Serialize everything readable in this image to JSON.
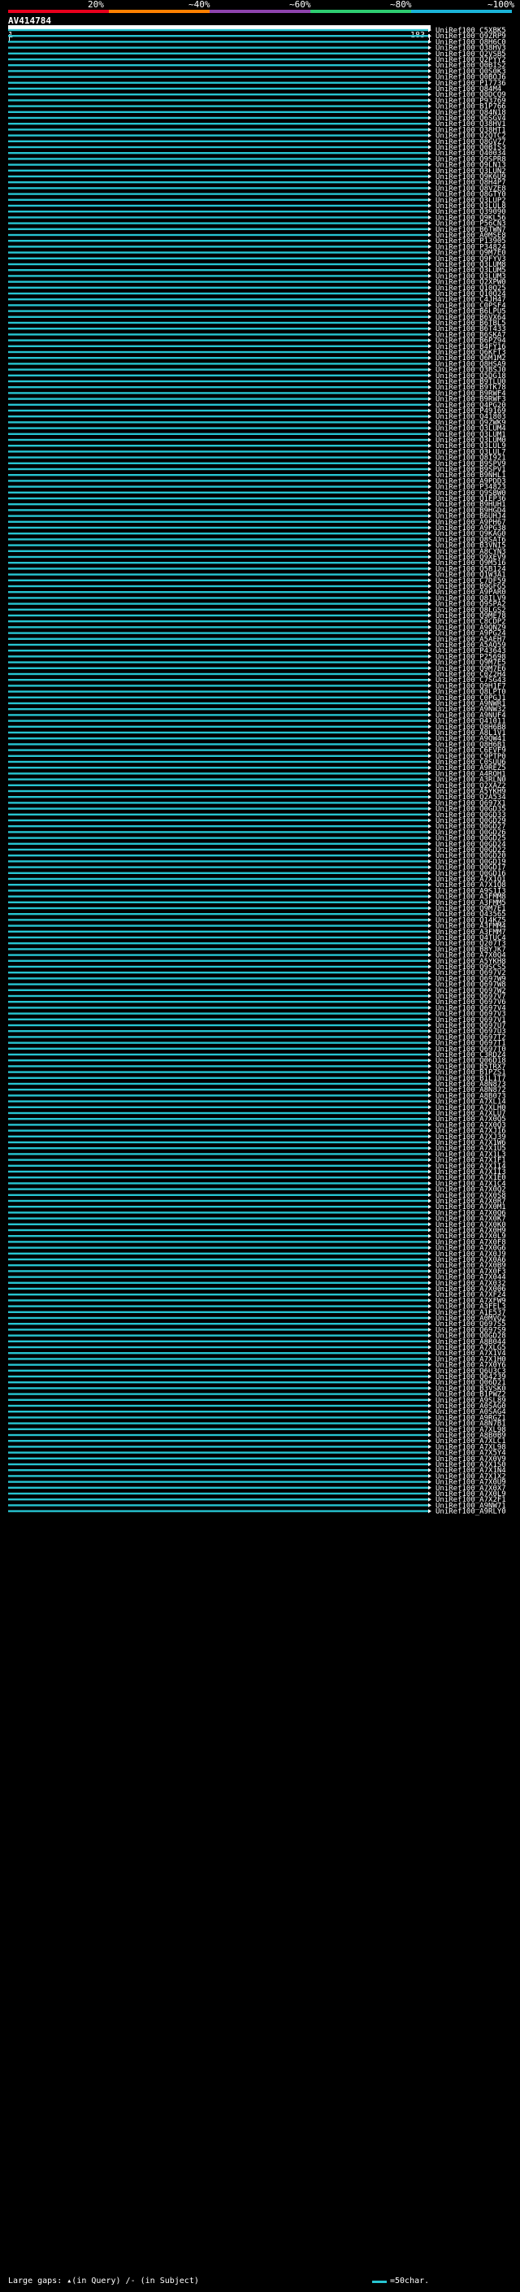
{
  "legend": {
    "percent_labels": [
      "20%",
      "40%",
      "60%",
      "80%",
      "100%"
    ],
    "percent_prefixes": [
      "",
      "~",
      "~",
      "~",
      "~"
    ],
    "colors": [
      "#e8001d",
      "#ff8000",
      "#8e44ad",
      "#2ecc71",
      "#1bb4d8"
    ]
  },
  "query": {
    "id": "AV414784",
    "start": "1",
    "end": "183"
  },
  "hit_color": "#27c4d1",
  "hits": [
    "UniRef100_C5XBK5",
    "UniRef100_Q9ZRP9",
    "UniRef100_Q8H6C0",
    "UniRef100_Q38HV3",
    "UniRef100_Q2VSB5",
    "UniRef100_Q2PYY2",
    "UniRef100_Q0BIS2",
    "UniRef100_Q0S0K3",
    "UniRef100_Q0BOJ6",
    "UniRef100_P17736",
    "UniRef100_Q84M4",
    "UniRef100_Q8DCQ9",
    "UniRef100_P93769",
    "UniRef100_B1P766",
    "UniRef100_Q84N18",
    "UniRef100_Q6SGV4",
    "UniRef100_Q38HV1",
    "UniRef100_Q38HT1",
    "UniRef100_Q2QTC2",
    "UniRef100_Q8GVZ7",
    "UniRef100_Q0BIS3",
    "UniRef100_Q40034",
    "UniRef100_Q9SPR8",
    "UniRef100_Q9LN13",
    "UniRef100_Q3LUN2",
    "UniRef100_Q9K6U9",
    "UniRef100_Q8H4P7",
    "UniRef100_Q8VZE8",
    "UniRef100_Q8GTY0",
    "UniRef100_Q3LUP2",
    "UniRef100_Q3LUL8",
    "UniRef100_Q39090",
    "UniRef100_Q9KL56",
    "UniRef100_P56CN3",
    "UniRef100_B6TWN7",
    "UniRef100_A0MSE8",
    "UniRef100_P13905",
    "UniRef100_P34824",
    "UniRef100_Q9M7E0",
    "UniRef100_Q9FYV3",
    "UniRef100_Q3LUM8",
    "UniRef100_Q3LUM5",
    "UniRef100_Q3LUM3",
    "UniRef100_Q2XPW0",
    "UniRef100_Q10Q25",
    "UniRef100_Q10Q24",
    "UniRef100_C4JH47",
    "UniRef100_C0PSF4",
    "UniRef100_B6LPU5",
    "UniRef100_B6VX64",
    "UniRef100_B6TBL5",
    "UniRef100_B6T433",
    "UniRef100_B6SKA7",
    "UniRef100_B6PZ94",
    "UniRef100_B4FY16",
    "UniRef100_Q6KFT3",
    "UniRef100_Q6M1M2",
    "UniRef100_Q8HSA9",
    "UniRef100_Q3BSJ0",
    "UniRef100_Q5DG18",
    "UniRef100_B9TLU0",
    "UniRef100_B9TK78",
    "UniRef100_B9RWF4",
    "UniRef100_B9RWF3",
    "UniRef100_Q4PG20",
    "UniRef100_P49169",
    "UniRef100_Q41803",
    "UniRef100_Q9ZWK9",
    "UniRef100_Q3LUM4",
    "UniRef100_Q3LUM1",
    "UniRef100_Q3LUM0",
    "UniRef100_Q3LUL9",
    "UniRef100_Q3LUL7",
    "UniRef100_Q8I921",
    "UniRef100_B9SPV9",
    "UniRef100_B9SPV1",
    "UniRef100_B9NHL1",
    "UniRef100_A9PDD3",
    "UniRef100_P34823",
    "UniRef100_Q9SBW0",
    "UniRef100_Q1EP36",
    "UniRef100_B9HUH1",
    "UniRef100_B9HGD4",
    "UniRef100_B6UHJ4",
    "UniRef100_A9PH67",
    "UniRef100_A9PG38",
    "UniRef100_Q9KAG0",
    "UniRef100_Q8SAT6",
    "UniRef100_B3VNI5",
    "UniRef100_A8CYN3",
    "UniRef100_Q9XEV9",
    "UniRef100_Q9M516",
    "UniRef100_Q5B124",
    "UniRef100_Q1W3A1",
    "UniRef100_C7DF59",
    "UniRef100_B9GFG5",
    "UniRef100_A9PAR0",
    "UniRef100_Q8ILV9",
    "UniRef100_Q9SPA2",
    "UniRef100_Q8LGS2",
    "UniRef100_Q9ME78",
    "UniRef100_C8CDP2",
    "UniRef100_A9QNZ9",
    "UniRef100_A9PG24",
    "UniRef100_A5AEH7",
    "UniRef100_A5AQ59",
    "UniRef100_P43643",
    "UniRef100_P25698",
    "UniRef100_Q9M7E5",
    "UniRef100_Q9M7E6",
    "UniRef100_C0Z2H4",
    "UniRef100_C7SG43",
    "UniRef100_Q9H1F7",
    "UniRef100_Q8LPT0",
    "UniRef100_C0PGJ1",
    "UniRef100_A9NWR1",
    "UniRef100_A9NW32",
    "UniRef100_A9NUF4",
    "UniRef100_Q41011",
    "UniRef100_Q8H6B8",
    "UniRef100_A8L1V1",
    "UniRef100_A9QW41",
    "UniRef100_Q8H6B1",
    "UniRef100_C6EVF9",
    "UniRef100_C9PTP0",
    "UniRef100_C0SUU6",
    "UniRef100_A9REZ5",
    "UniRef100_A4RQH1",
    "UniRef100_A3RLN0",
    "UniRef100_Q2XAZ2",
    "UniRef100_A5YKH9",
    "UniRef100_Q2A534",
    "UniRef100_Q697X1",
    "UniRef100_Q0GD35",
    "UniRef100_Q0GD33",
    "UniRef100_Q0GD29",
    "UniRef100_Q0GD27",
    "UniRef100_Q0GD26",
    "UniRef100_Q0GD25",
    "UniRef100_Q0GD24",
    "UniRef100_Q0GD22",
    "UniRef100_Q0GD20",
    "UniRef100_Q0GD19",
    "UniRef100_Q0GD17",
    "UniRef100_Q0GD16",
    "UniRef100_A7X1Q1",
    "UniRef100_A7X1Q8",
    "UniRef100_A9S1I3",
    "UniRef100_A3FMM8",
    "UniRef100_A3FMM5",
    "UniRef100_Q9M7E1",
    "UniRef100_Q43565",
    "UniRef100_Q14KZ5",
    "UniRef100_A3FMM4",
    "UniRef100_A3FMM7",
    "UniRef100_Q4TUC4",
    "UniRef100_Q207T3",
    "UniRef100_B8YJK7",
    "UniRef100_A7X0Q4",
    "UniRef100_A5YKH8",
    "UniRef100_Q9SCS5",
    "UniRef100_Q697V2",
    "UniRef100_Q697W9",
    "UniRef100_Q697W8",
    "UniRef100_Q697W2",
    "UniRef100_Q697V7",
    "UniRef100_Q697V6",
    "UniRef100_Q697V4",
    "UniRef100_Q697V3",
    "UniRef100_Q697V1",
    "UniRef100_Q697U7",
    "UniRef100_Q697U3",
    "UniRef100_Q697T2",
    "UniRef100_Q697T1",
    "UniRef100_Q697T0",
    "UniRef100_C3RDZ4",
    "UniRef100_Q06D18",
    "UniRef100_B5TRX7",
    "UniRef100_B1PZS1",
    "UniRef100_B1L1T7",
    "UniRef100_A8N873",
    "UniRef100_A8N872",
    "UniRef100_A8B073",
    "UniRef100_A7XL14",
    "UniRef100_A7XLH0",
    "UniRef100_A7XLU7",
    "UniRef100_A7X0Q5",
    "UniRef100_A7X0Q3",
    "UniRef100_A7XJ16",
    "UniRef100_A7XJ39",
    "UniRef100_A7X1W6",
    "UniRef100_A7X1U5",
    "UniRef100_A7X1L3",
    "UniRef100_A7X1F1",
    "UniRef100_A7X1I4",
    "UniRef100_A7X1I3",
    "UniRef100_A7X1E0",
    "UniRef100_A7X1C4",
    "UniRef100_A7X0Q2",
    "UniRef100_A7X0S8",
    "UniRef100_A7X0R7",
    "UniRef100_A7X0M1",
    "UniRef100_A7X0Q6",
    "UniRef100_A7X0K7",
    "UniRef100_A7X0K0",
    "UniRef100_A7X0H9",
    "UniRef100_A7X0L9",
    "UniRef100_A7X0F8",
    "UniRef100_A7X0G6",
    "UniRef100_A7X0J9",
    "UniRef100_A7X0A6",
    "UniRef100_A7X0B9",
    "UniRef100_A7X0F3",
    "UniRef100_A7X044",
    "UniRef100_A7X032",
    "UniRef100_A7X006",
    "UniRef100_A7XF24",
    "UniRef100_A7XFW9",
    "UniRef100_A3FEL3",
    "UniRef100_A1E537",
    "UniRef100_A0MVG2",
    "UniRef100_Q697S5",
    "UniRef100_Q697S9",
    "UniRef100_Q0GD28",
    "UniRef100_A8B044",
    "UniRef100_A7XLG5",
    "UniRef100_A7X1V4",
    "UniRef100_A7X1H0",
    "UniRef100_A7X0Y6",
    "UniRef100_Q6U3C3",
    "UniRef100_Q64239",
    "UniRef100_Q06D21",
    "UniRef100_B3VSK0",
    "UniRef100_B1PWZ2",
    "UniRef100_A9SL89",
    "UniRef100_A0SAG0",
    "UniRef100_A0SAG4",
    "UniRef100_A9RGZ1",
    "UniRef100_A8N7B1",
    "UniRef100_A7XL98",
    "UniRef100_A8B0B9",
    "UniRef100_A7XLC1",
    "UniRef100_A7XL98",
    "UniRef100_A7X5Y4",
    "UniRef100_A7X0V9",
    "UniRef100_A7X1S0",
    "UniRef100_A7X1N4",
    "UniRef100_A7X1X2",
    "UniRef100_A7X0U9",
    "UniRef100_A7X0X7",
    "UniRef100_A7X0L9",
    "UniRef100_A7X2F1",
    "UniRef100_A9NW71",
    "UniRef100_A9RLY0"
  ],
  "footer": {
    "gaps_label": "Large gaps:",
    "in_query": "(in Query)",
    "in_subject": "(in Subject)",
    "scale_label": "=50char."
  }
}
